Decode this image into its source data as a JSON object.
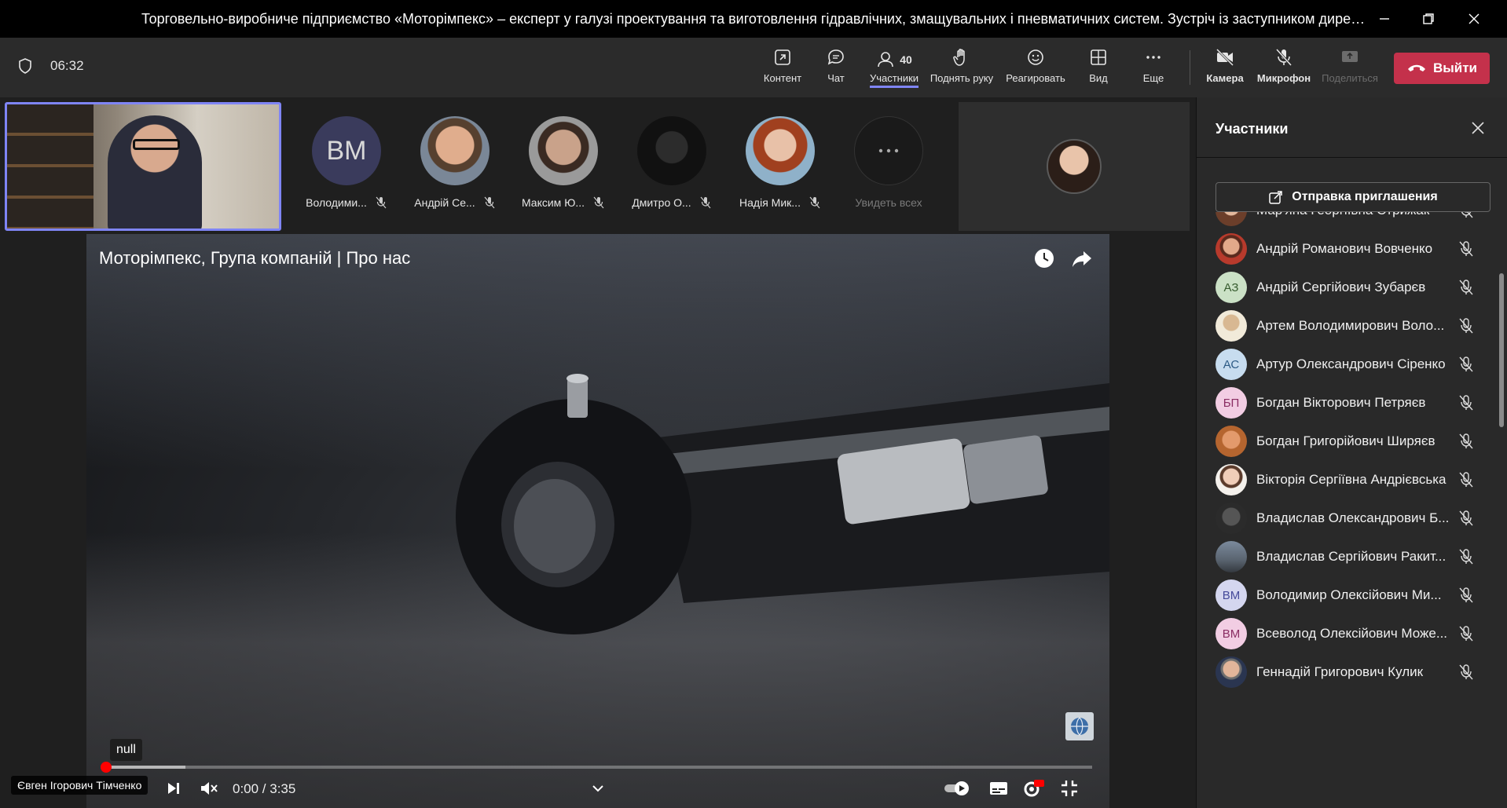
{
  "window": {
    "title": "Торговельно-виробниче підприємство «Моторімпекс» – експерт у галузі проектування та виготовлення гідравлічних, змащувальних і пневматичних систем. Зустріч із заступником директора ..."
  },
  "toolbar": {
    "timer": "06:32",
    "content_label": "Контент",
    "chat_label": "Чат",
    "participants_label": "Участники",
    "participants_count": "40",
    "raise_hand_label": "Поднять руку",
    "react_label": "Реагировать",
    "view_label": "Вид",
    "more_label": "Еще",
    "camera_label": "Камера",
    "mic_label": "Микрофон",
    "share_label": "Поделиться",
    "leave_label": "Выйти"
  },
  "strip": {
    "thumbs": [
      {
        "initials": "ВМ",
        "name": "Володими..."
      },
      {
        "initials": "",
        "name": "Андрій Се..."
      },
      {
        "initials": "",
        "name": "Максим Ю..."
      },
      {
        "initials": "",
        "name": "Дмитро О..."
      },
      {
        "initials": "",
        "name": "Надія Мик..."
      }
    ],
    "see_all_label": "Увидеть всех"
  },
  "video": {
    "title": "Моторімпекс, Група компаній | Про нас",
    "tooltip": "null",
    "time": "0:00 / 3:35",
    "progress": 0.0,
    "presenter_caption": "Євген Ігорович Тімченко"
  },
  "panel": {
    "title": "Участники",
    "invite_label": "Отправка приглашения",
    "participants": [
      {
        "initials": "",
        "name": "Мар'яна Георгіївна Стрижак"
      },
      {
        "initials": "",
        "name": "Андрій Романович Вовченко"
      },
      {
        "initials": "АЗ",
        "name": "Андрій Сергійович Зубарєв"
      },
      {
        "initials": "",
        "name": "Артем Володимирович Воло..."
      },
      {
        "initials": "АС",
        "name": "Артур Олександрович Сіренко"
      },
      {
        "initials": "БП",
        "name": "Богдан Вікторович Петряєв"
      },
      {
        "initials": "",
        "name": "Богдан Григорійович Ширяєв"
      },
      {
        "initials": "",
        "name": "Вікторія Сергіївна Андрієвська"
      },
      {
        "initials": "",
        "name": "Владислав Олександрович Б..."
      },
      {
        "initials": "",
        "name": "Владислав Сергійович Ракит..."
      },
      {
        "initials": "ВМ",
        "name": "Володимир Олексійович Ми..."
      },
      {
        "initials": "ВМ",
        "name": "Всеволод Олексійович Може..."
      },
      {
        "initials": "",
        "name": "Геннадій Григорович Кулик"
      }
    ]
  },
  "colors": {
    "accent": "#7f85f5",
    "leave": "#c4314b",
    "progress_dot": "#ff0000"
  }
}
